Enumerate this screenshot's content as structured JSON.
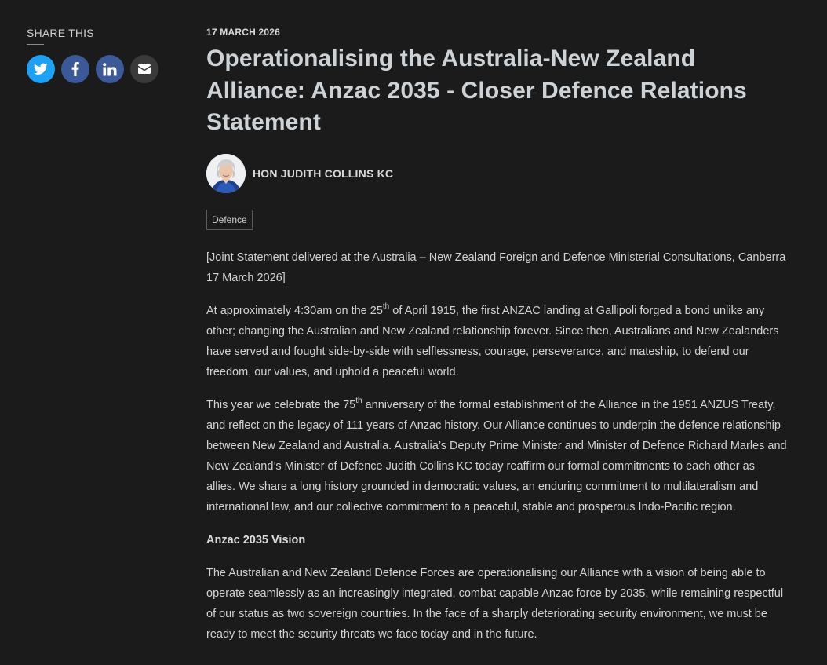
{
  "share": {
    "title": "SHARE THIS",
    "buttons": [
      {
        "name": "twitter-icon",
        "color": "#1da1f2"
      },
      {
        "name": "facebook-icon",
        "color": "#3b5998"
      },
      {
        "name": "linkedin-icon",
        "color": "#3d5a98"
      },
      {
        "name": "email-icon",
        "color": "#3a3a3a"
      }
    ]
  },
  "article": {
    "date": "17 MARCH 2026",
    "title": "Operationalising the Australia-New Zealand Alliance: Anzac 2035 - Closer Defence Relations Statement",
    "author": "HON JUDITH COLLINS KC",
    "tag": "Defence",
    "p1": "[Joint Statement delivered at the Australia – New Zealand Foreign and Defence Ministerial Consultations, Canberra 17 March 2026]",
    "p2_a": "At approximately 4:30am on the 25",
    "p2_sup": "th",
    "p2_b": " of April 1915, the first ANZAC landing at Gallipoli forged a bond unlike any other; changing the Australian and New Zealand relationship forever. Since then, Australians and New Zealanders have served and fought side-by-side with selflessness, courage, perseverance, and mateship, to defend our freedom, our values, and uphold a peaceful world.",
    "p3_a": "This year we celebrate the 75",
    "p3_sup": "th",
    "p3_b": " anniversary of the formal establishment of the Alliance in the 1951 ANZUS Treaty, and reflect on the legacy of 111 years of Anzac history. Our Alliance continues to underpin the defence relationship between New Zealand and Australia. Australia’s Deputy Prime Minister and Minister of Defence Richard Marles and New Zealand’s Minister of Defence Judith Collins KC today reaffirm our formal commitments to each other as allies. We share a long history grounded in democratic values, an enduring commitment to multilateralism and international law, and our collective commitment to a peaceful, stable and prosperous Indo-Pacific region.",
    "subhead": "Anzac 2035 Vision",
    "p4": "The Australian and New Zealand Defence Forces are operationalising our Alliance with a vision of being able to operate seamlessly as an increasingly integrated, combat capable Anzac force by 2035, while remaining respectful of our status as two sovereign countries. In the face of a sharply deteriorating security environment, we must be ready to meet the security threats we face today and in the future."
  }
}
